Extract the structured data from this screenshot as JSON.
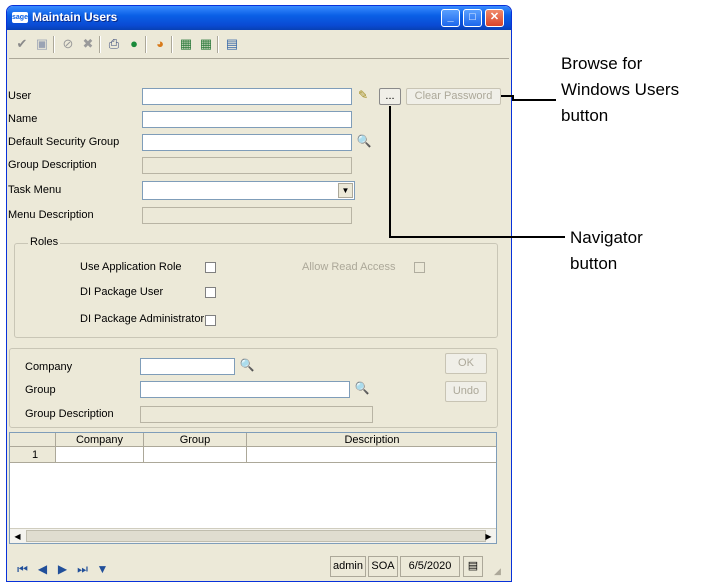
{
  "window": {
    "title": "Maintain Users",
    "logo": "sage"
  },
  "titlebar_buttons": {
    "minimize": "_",
    "maximize": "□",
    "close": "✕"
  },
  "toolbar": {
    "icons": [
      "accept-icon",
      "save-icon",
      "cancel-icon",
      "delete-icon",
      "print-icon",
      "help-icon",
      "palette-icon",
      "export-icon",
      "import-icon",
      "document-icon"
    ]
  },
  "form": {
    "user_label": "User",
    "name_label": "Name",
    "security_group_label": "Default Security Group",
    "group_description_label": "Group Description",
    "task_menu_label": "Task Menu",
    "menu_description_label": "Menu Description",
    "browse_button": "...",
    "clear_password_button": "Clear Password"
  },
  "roles": {
    "title": "Roles",
    "use_app_role": "Use Application Role",
    "allow_read": "Allow Read Access",
    "di_package_user": "DI Package User",
    "di_package_admin": "DI Package Administrator"
  },
  "company_section": {
    "company_label": "Company",
    "group_label": "Group",
    "group_description_label": "Group Description",
    "ok_button": "OK",
    "undo_button": "Undo"
  },
  "grid": {
    "columns": [
      "Company",
      "Group",
      "Description"
    ],
    "rows": [
      {
        "num": "1",
        "company": "",
        "group": "",
        "description": ""
      }
    ]
  },
  "status": {
    "user": "admin",
    "company": "SOA",
    "date": "6/5/2020"
  },
  "callouts": {
    "browse_line1": "Browse for",
    "browse_line2": "Windows Users",
    "browse_line3": "button",
    "navigator_line1": "Navigator",
    "navigator_line2": "button"
  }
}
